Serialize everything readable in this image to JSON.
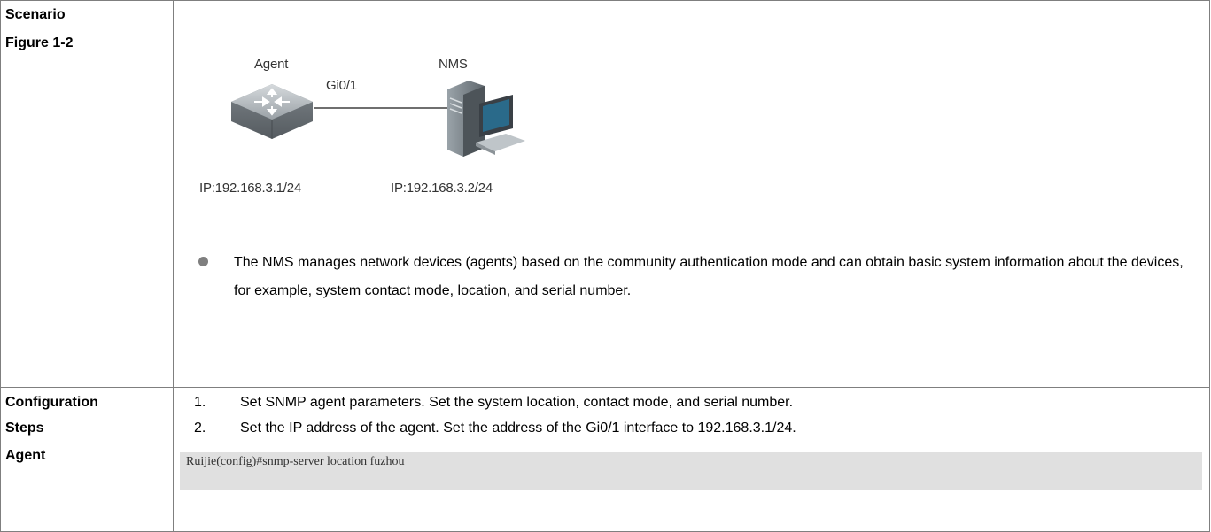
{
  "rows": {
    "scenario": {
      "label_line1": "Scenario",
      "label_line2": "Figure 1-2",
      "figure": {
        "agent_label": "Agent",
        "nms_label": "NMS",
        "link_label": "Gi0/1",
        "agent_ip": "IP:192.168.3.1/24",
        "nms_ip": "IP:192.168.3.2/24",
        "agent_icon": "switch-icon",
        "nms_icon": "computer-icon"
      },
      "bullet_text": "The NMS manages network devices (agents) based on the community authentication mode and can obtain basic system information about the devices, for example, system contact mode, location, and serial number."
    },
    "configuration": {
      "label_line1": "Configuration",
      "label_line2": "Steps",
      "steps": [
        {
          "num": "1.",
          "text": "Set SNMP agent parameters. Set the system location, contact mode, and serial number."
        },
        {
          "num": "2.",
          "text": "Set the IP address of the agent. Set the address of the Gi0/1 interface to 192.168.3.1/24."
        }
      ]
    },
    "agent": {
      "label": "Agent",
      "code": "Ruijie(config)#snmp-server location fuzhou"
    }
  },
  "colors": {
    "border": "#7f7f7f",
    "code_bg": "#e0e0e0",
    "bullet": "#7f7f7f"
  }
}
